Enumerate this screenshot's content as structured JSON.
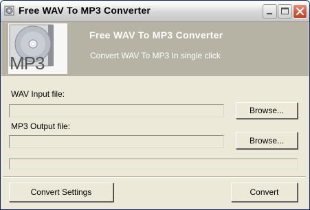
{
  "window": {
    "title": "Free WAV To MP3 Converter",
    "controls": [
      "minimize",
      "maximize",
      "close"
    ]
  },
  "banner": {
    "title": "Free WAV To MP3 Converter",
    "subtitle": "Convert WAV To MP3 In single click",
    "logo_text": "MP3",
    "background": "#b6b3a4"
  },
  "form": {
    "wav_input_label": "WAV Input file:",
    "wav_input_value": "",
    "mp3_output_label": "MP3 Output file:",
    "mp3_output_value": "",
    "browse_label": "Browse...",
    "progress": 0
  },
  "footer": {
    "settings_label": "Convert Settings",
    "convert_label": "Convert"
  },
  "colors": {
    "window_face": "#ece9d8",
    "close_button": "#d65a3d"
  }
}
